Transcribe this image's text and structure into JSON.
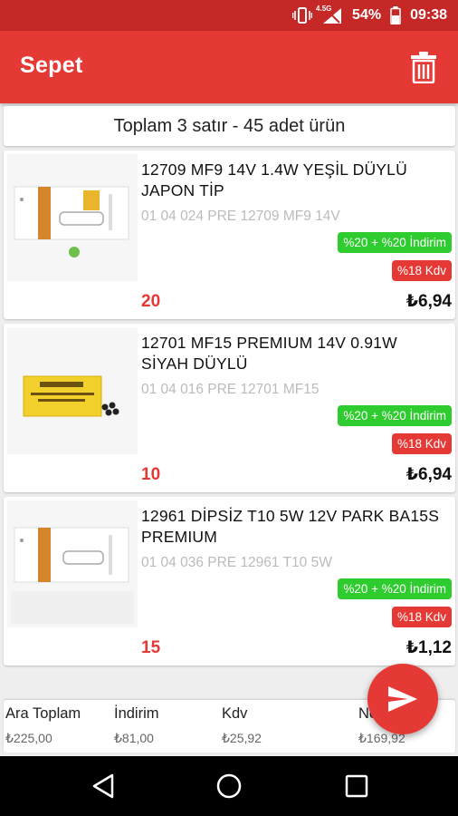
{
  "status_bar": {
    "network": "4.5G",
    "battery": "54%",
    "time": "09:38"
  },
  "app_bar": {
    "title": "Sepet",
    "delete_icon": "trash-icon"
  },
  "summary": {
    "text": "Toplam 3 satır - 45 adet ürün"
  },
  "products": [
    {
      "name": "12709 MF9 14V 1.4W YEŞİL DÜYLÜ JAPON TİP",
      "code": "01 04 024 PRE 12709 MF9 14V",
      "discount": "%20 + %20 İndirim",
      "kdv": "%18 Kdv",
      "quantity": "20",
      "price": "₺6,94"
    },
    {
      "name": "12701 MF15 PREMIUM 14V 0.91W SİYAH DÜYLÜ",
      "code": "01 04 016 PRE 12701 MF15",
      "discount": "%20 + %20 İndirim",
      "kdv": "%18 Kdv",
      "quantity": "10",
      "price": "₺6,94"
    },
    {
      "name": "12961 DİPSİZ T10 5W 12V PARK BA15S PREMIUM",
      "code": "01 04 036 PRE 12961 T10 5W",
      "discount": "%20 + %20 İndirim",
      "kdv": "%18 Kdv",
      "quantity": "15",
      "price": "₺1,12"
    }
  ],
  "totals": {
    "subtotal_label": "Ara Toplam",
    "subtotal_value": "₺225,00",
    "discount_label": "İndirim",
    "discount_value": "₺81,00",
    "kdv_label": "Kdv",
    "kdv_value": "₺25,92",
    "net_label": "Net",
    "net_value": "₺169,92"
  },
  "fab": {
    "icon": "send-icon"
  },
  "nav": {
    "back_icon": "back-icon",
    "home_icon": "home-icon",
    "recents_icon": "recents-icon"
  },
  "colors": {
    "primary": "#e53935",
    "primary_dark": "#c62828",
    "discount_green": "#2ecc2e"
  }
}
